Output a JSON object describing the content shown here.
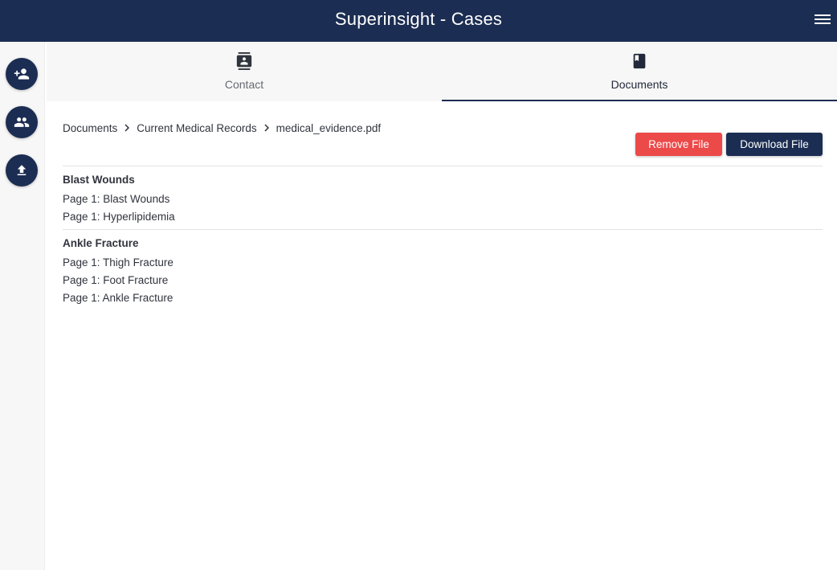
{
  "header": {
    "title": "Superinsight - Cases",
    "menu_icon": "menu-icon"
  },
  "sidebar": {
    "buttons": [
      {
        "name": "add-person-button",
        "icon": "person-add-icon"
      },
      {
        "name": "people-button",
        "icon": "people-icon"
      },
      {
        "name": "upload-button",
        "icon": "upload-icon"
      }
    ]
  },
  "tabs": [
    {
      "label": "Contact",
      "icon": "contact-card-icon",
      "active": false
    },
    {
      "label": "Documents",
      "icon": "book-icon",
      "active": true
    }
  ],
  "breadcrumb": {
    "items": [
      "Documents",
      "Current Medical Records",
      "medical_evidence.pdf"
    ],
    "separator_icon": "chevron-right-icon"
  },
  "actions": {
    "remove_label": "Remove File",
    "download_label": "Download File"
  },
  "groups": [
    {
      "title": "Blast Wounds",
      "entries": [
        "Page 1: Blast Wounds",
        "Page 1: Hyperlipidemia"
      ]
    },
    {
      "title": "Ankle Fracture",
      "entries": [
        "Page 1: Thigh Fracture",
        "Page 1: Foot Fracture",
        "Page 1: Ankle Fracture"
      ]
    }
  ],
  "colors": {
    "primary": "#1b2d52",
    "danger": "#ec4949",
    "sidebar_bg": "#f7f7f7"
  }
}
